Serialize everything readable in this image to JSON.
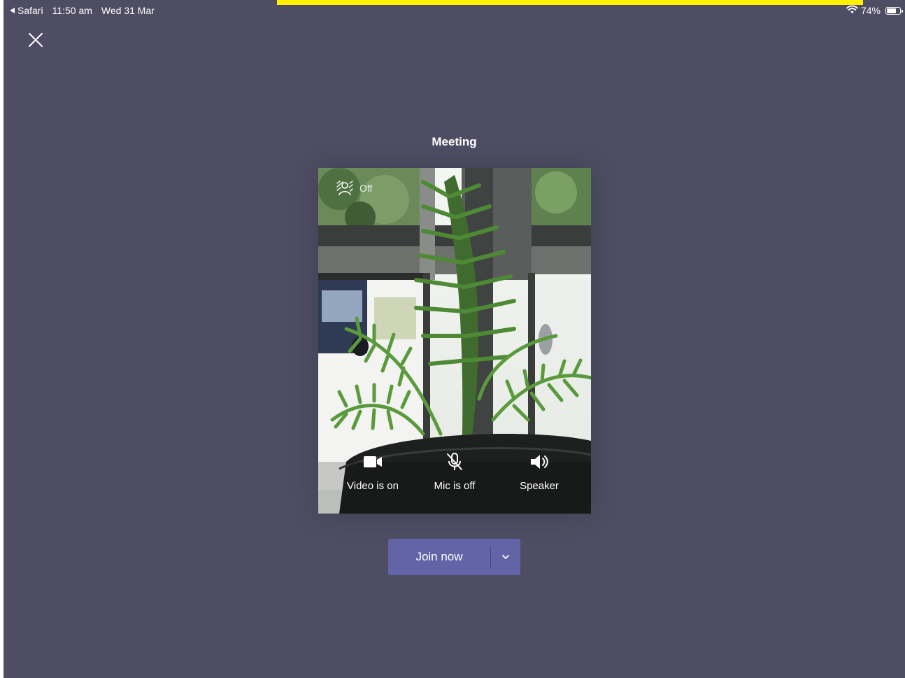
{
  "status_bar": {
    "back_app": "Safari",
    "time": "11:50 am",
    "date": "Wed 31 Mar",
    "battery": "74%",
    "battery_level": 0.74,
    "wifi_icon": "wifi-icon"
  },
  "colors": {
    "background": "#4f4d63",
    "accent": "#6264a7",
    "highlight_bar": "#fff200"
  },
  "header": {
    "close_icon": "close-icon"
  },
  "meeting": {
    "title": "Meeting"
  },
  "preview": {
    "background_effects_label": "Off",
    "background_effects_icon": "background-blur-icon",
    "controls": [
      {
        "label": "Video is on",
        "icon": "video-camera-icon"
      },
      {
        "label": "Mic is off",
        "icon": "mic-off-icon"
      },
      {
        "label": "Speaker",
        "icon": "speaker-icon"
      }
    ]
  },
  "join": {
    "label": "Join now",
    "dropdown_icon": "chevron-down-icon"
  }
}
